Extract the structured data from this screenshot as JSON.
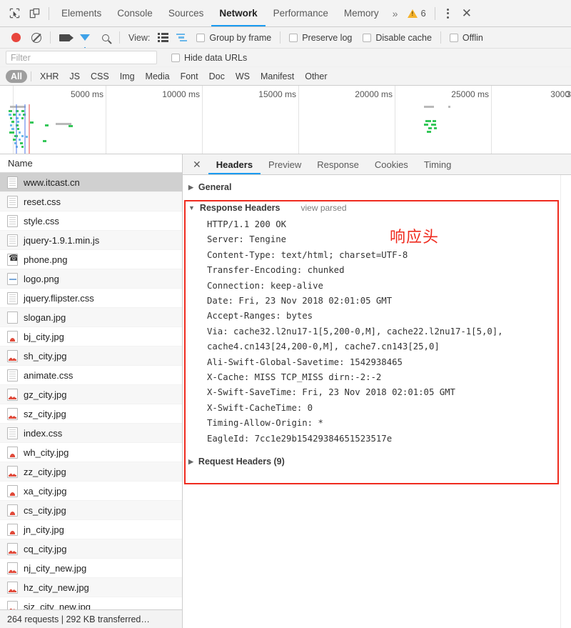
{
  "window": {
    "main_tabs": [
      {
        "label": "Elements",
        "active": false
      },
      {
        "label": "Console",
        "active": false
      },
      {
        "label": "Sources",
        "active": false
      },
      {
        "label": "Network",
        "active": true
      },
      {
        "label": "Performance",
        "active": false
      },
      {
        "label": "Memory",
        "active": false
      }
    ],
    "overflow_chevron": "»",
    "warning_count": "6",
    "inspect_icon": "inspect-element-icon",
    "device_icon": "device-toolbar-icon",
    "menu_icon": "kebab-menu-icon",
    "close_icon": "close-icon"
  },
  "network_toolbar": {
    "record_label": "record-button",
    "clear_label": "clear-button",
    "capture_screenshots_label": "camera-icon",
    "filter_toggle_label": "filter-icon",
    "search_label": "search-icon",
    "view_label": "View:",
    "checkboxes": [
      {
        "label": "Group by frame",
        "checked": false
      },
      {
        "label": "Preserve log",
        "checked": false
      },
      {
        "label": "Disable cache",
        "checked": false
      },
      {
        "label": "Offlin",
        "checked": false
      }
    ]
  },
  "filter_row": {
    "placeholder": "Filter",
    "value": "",
    "hide_data_urls": {
      "label": "Hide data URLs",
      "checked": false
    }
  },
  "type_filters": [
    {
      "label": "All",
      "active": true
    },
    {
      "label": "XHR",
      "active": false
    },
    {
      "label": "JS",
      "active": false
    },
    {
      "label": "CSS",
      "active": false
    },
    {
      "label": "Img",
      "active": false
    },
    {
      "label": "Media",
      "active": false
    },
    {
      "label": "Font",
      "active": false
    },
    {
      "label": "Doc",
      "active": false
    },
    {
      "label": "WS",
      "active": false
    },
    {
      "label": "Manifest",
      "active": false
    },
    {
      "label": "Other",
      "active": false
    }
  ],
  "overview": {
    "ticks": [
      "5000 ms",
      "10000 ms",
      "15000 ms",
      "20000 ms",
      "25000 ms",
      "3000"
    ]
  },
  "request_list": {
    "column_header": "Name",
    "rows": [
      {
        "name": "www.itcast.cn",
        "icon": "document-icon",
        "selected": true
      },
      {
        "name": "reset.css",
        "icon": "document-icon",
        "selected": false
      },
      {
        "name": "style.css",
        "icon": "document-icon",
        "selected": false
      },
      {
        "name": "jquery-1.9.1.min.js",
        "icon": "document-icon",
        "selected": false
      },
      {
        "name": "phone.png",
        "icon": "phone-image-icon",
        "selected": false
      },
      {
        "name": "logo.png",
        "icon": "logo-image-icon",
        "selected": false
      },
      {
        "name": "jquery.flipster.css",
        "icon": "document-icon",
        "selected": false
      },
      {
        "name": "slogan.jpg",
        "icon": "blank-image-icon",
        "selected": false
      },
      {
        "name": "bj_city.jpg",
        "icon": "city-image-icon",
        "selected": false
      },
      {
        "name": "sh_city.jpg",
        "icon": "city-image-icon",
        "selected": false
      },
      {
        "name": "animate.css",
        "icon": "document-icon",
        "selected": false
      },
      {
        "name": "gz_city.jpg",
        "icon": "city-image-icon",
        "selected": false
      },
      {
        "name": "sz_city.jpg",
        "icon": "city-image-icon",
        "selected": false
      },
      {
        "name": "index.css",
        "icon": "document-icon",
        "selected": false
      },
      {
        "name": "wh_city.jpg",
        "icon": "city-image-icon",
        "selected": false
      },
      {
        "name": "zz_city.jpg",
        "icon": "city-image-icon",
        "selected": false
      },
      {
        "name": "xa_city.jpg",
        "icon": "city-image-icon",
        "selected": false
      },
      {
        "name": "cs_city.jpg",
        "icon": "city-image-icon",
        "selected": false
      },
      {
        "name": "jn_city.jpg",
        "icon": "city-image-icon",
        "selected": false
      },
      {
        "name": "cq_city.jpg",
        "icon": "city-image-icon",
        "selected": false
      },
      {
        "name": "nj_city_new.jpg",
        "icon": "city-image-icon",
        "selected": false
      },
      {
        "name": "hz_city_new.jpg",
        "icon": "city-image-icon",
        "selected": false
      },
      {
        "name": "sjz_city_new.jpg",
        "icon": "city-image-icon",
        "selected": false
      }
    ],
    "summary": "264 requests | 292 KB transferred…"
  },
  "detail_panel": {
    "close_icon": "close-icon",
    "tabs": [
      {
        "label": "Headers",
        "active": true
      },
      {
        "label": "Preview",
        "active": false
      },
      {
        "label": "Response",
        "active": false
      },
      {
        "label": "Cookies",
        "active": false
      },
      {
        "label": "Timing",
        "active": false
      }
    ],
    "sections": {
      "general": {
        "title": "General",
        "expanded": false,
        "triangle": "▶"
      },
      "response_headers": {
        "title": "Response Headers",
        "expanded": true,
        "triangle": "▼",
        "view_parsed": "view parsed",
        "lines": [
          "HTTP/1.1 200 OK",
          "Server: Tengine",
          "Content-Type: text/html; charset=UTF-8",
          "Transfer-Encoding: chunked",
          "Connection: keep-alive",
          "Date: Fri, 23 Nov 2018 02:01:05 GMT",
          "Accept-Ranges: bytes",
          "Via: cache32.l2nu17-1[5,200-0,M], cache22.l2nu17-1[5,0],",
          "cache4.cn143[24,200-0,M], cache7.cn143[25,0]",
          "Ali-Swift-Global-Savetime: 1542938465",
          "X-Cache: MISS TCP_MISS dirn:-2:-2",
          "X-Swift-SaveTime: Fri, 23 Nov 2018 02:01:05 GMT",
          "X-Swift-CacheTime: 0",
          "Timing-Allow-Origin: *",
          "EagleId: 7cc1e29b15429384651523517e"
        ]
      },
      "request_headers": {
        "title": "Request Headers (9)",
        "expanded": false,
        "triangle": "▶"
      }
    }
  },
  "annotation": {
    "text": "响应头",
    "color": "#ef2b1f"
  }
}
